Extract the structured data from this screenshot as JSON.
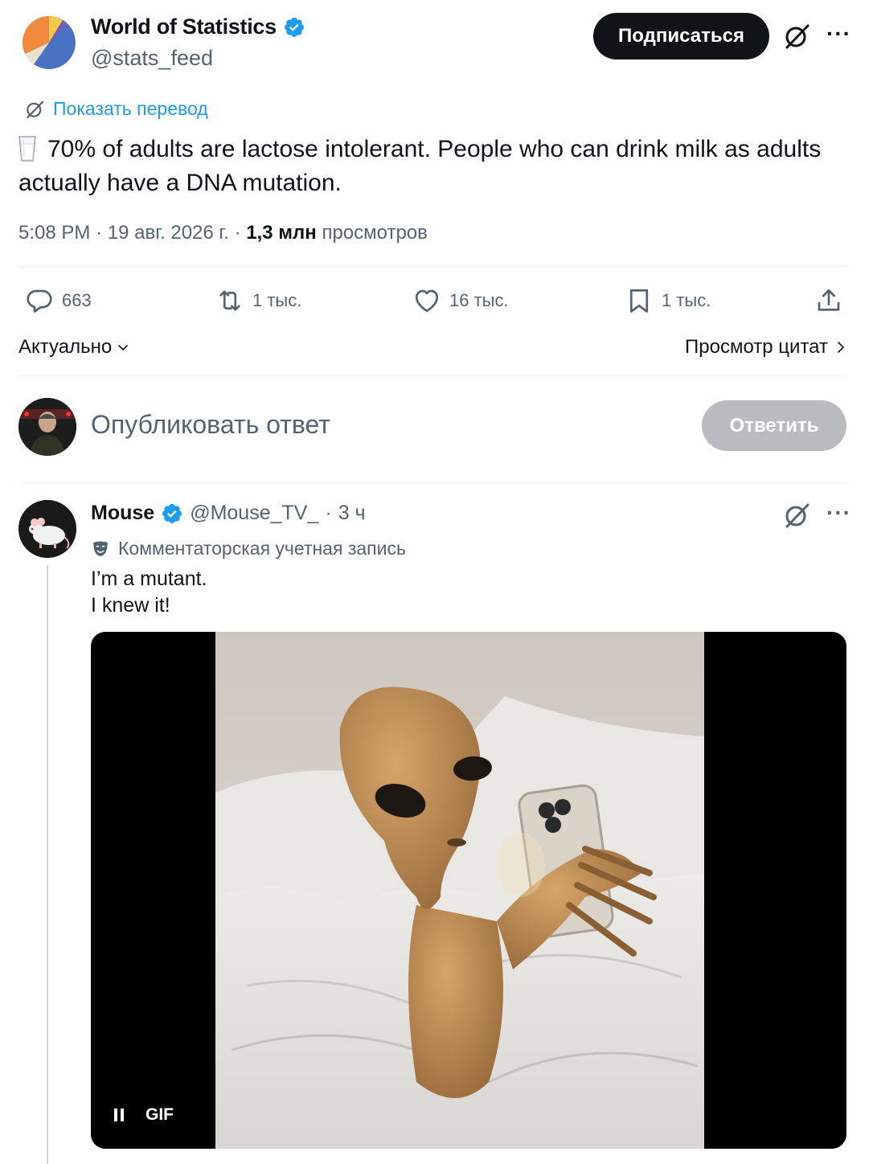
{
  "tweet": {
    "author_name": "World of Statistics",
    "author_handle": "@stats_feed",
    "follow_label": "Подписаться",
    "translate_label": "Показать перевод",
    "text": "70% of adults are lactose intolerant. People who can drink milk as adults actually have a DNA mutation.",
    "time": "5:08 PM",
    "date": "19 авг. 2026 г.",
    "views_count": "1,3 млн",
    "views_label": "просмотров",
    "replies": "663",
    "reposts": "1 тыс.",
    "likes": "16 тыс.",
    "bookmarks": "1 тыс."
  },
  "controls": {
    "sort_label": "Актуально",
    "quotes_label": "Просмотр цитат"
  },
  "compose": {
    "placeholder": "Опубликовать ответ",
    "reply_label": "Ответить"
  },
  "reply": {
    "author_name": "Mouse",
    "author_handle": "@Mouse_TV_",
    "time": "3 ч",
    "account_label": "Комментаторская учетная запись",
    "line1": "I’m a mutant.",
    "line2": "I knew it!",
    "gif_label": "GIF"
  },
  "colors": {
    "accent": "#1d9bf0",
    "text": "#0f1419",
    "muted": "#536471",
    "reply_button_disabled": "#b9bcbe"
  },
  "icons": [
    "verified-badge-icon",
    "grok-icon",
    "more-icon",
    "reply-icon",
    "repost-icon",
    "like-icon",
    "bookmark-icon",
    "share-icon",
    "chevron-down-icon",
    "chevron-right-icon",
    "comedy-mask-icon",
    "pause-icon",
    "milk-glass-icon"
  ]
}
